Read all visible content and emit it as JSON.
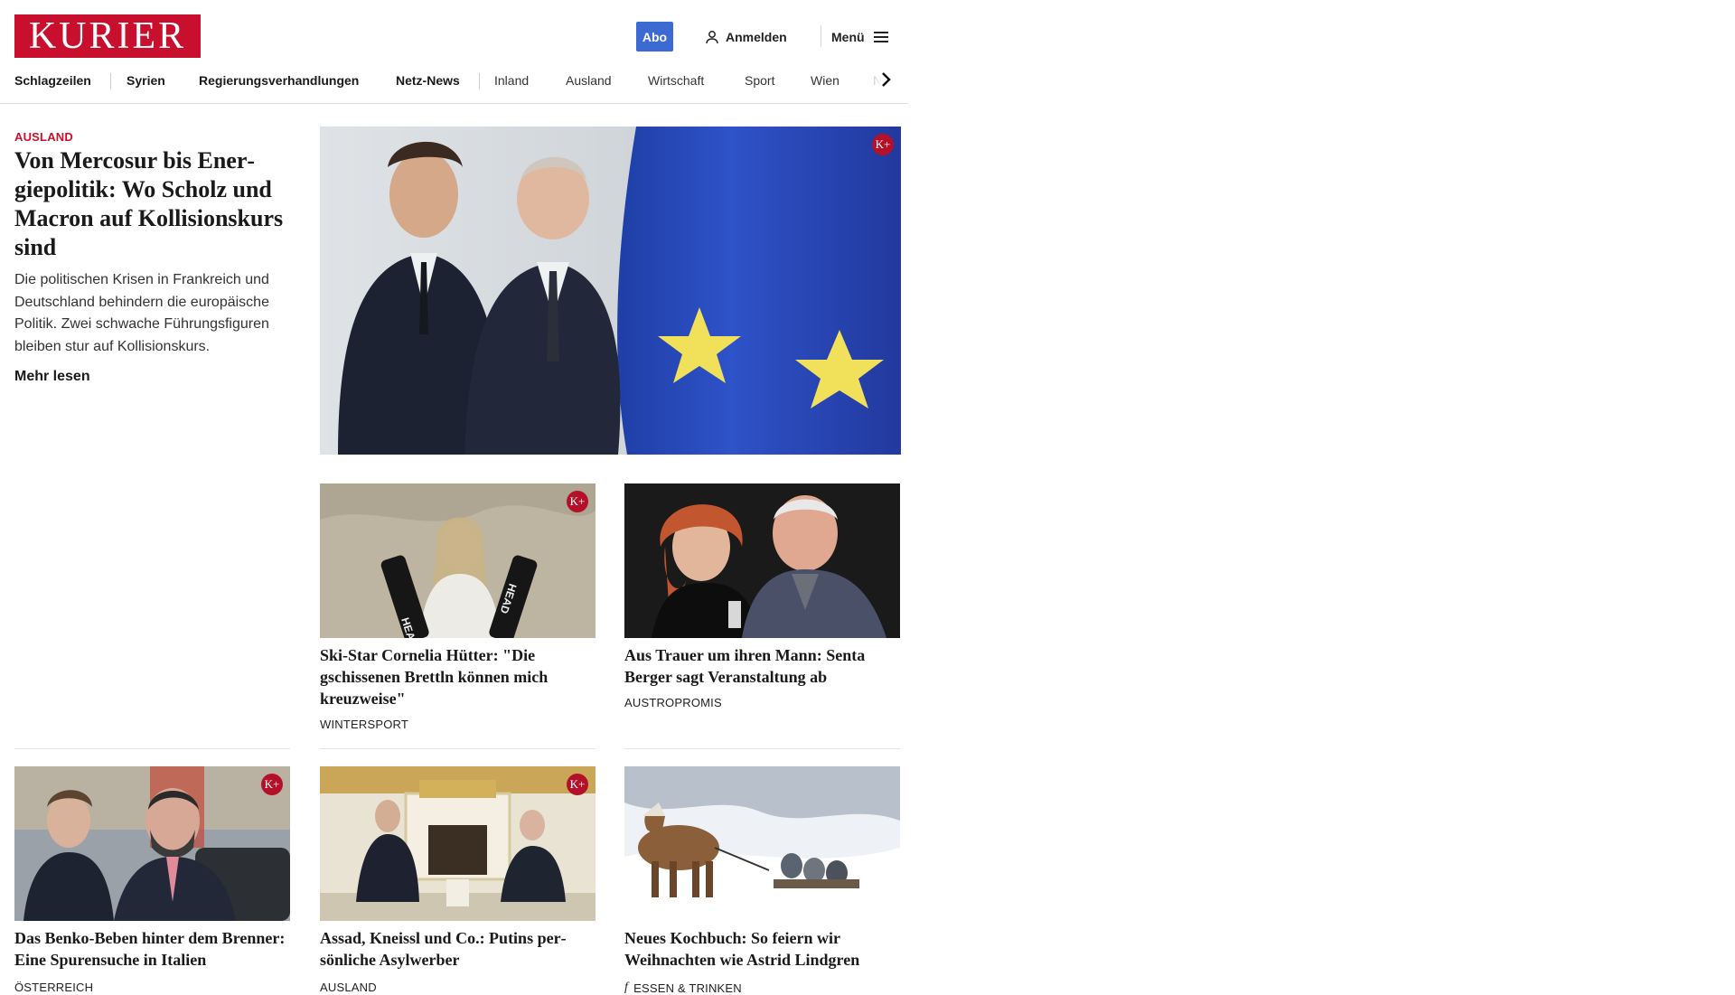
{
  "header": {
    "logo_text": "KURIER",
    "abo_label": "Abo",
    "login_label": "Anmelden",
    "menu_label": "Menü",
    "icons": [
      "user-icon",
      "hamburger-menu-icon"
    ]
  },
  "nav": {
    "items": [
      "Schlagzeilen",
      "Syrien",
      "Regierungsverhandlungen",
      "Netz-News",
      "Inland",
      "Ausland",
      "Wirtschaft",
      "Sport",
      "Wien",
      "NÖ"
    ]
  },
  "lead": {
    "kicker": "AUSLAND",
    "title": "Von Mercosur bis Ener­giepolitik: Wo Scholz und Macron auf Kollisions­kurs sind",
    "teaser": "Die politischen Krisen in Frankreich und Deutschland behindern die europäische Politik. Zwei schwache Führungsfiguren bleiben stur auf Kollisionskurs.",
    "more_label": "Mehr lesen",
    "badge": "K+"
  },
  "cards": [
    {
      "title": "Ski-Star Cornelia Hütter: \"Die gschissenen Brettln können mich kreuzweise\"",
      "kicker": "WINTERSPORT",
      "badge": "K+"
    },
    {
      "title": "Aus Trauer um ihren Mann: Senta Berger sagt Veranstaltung ab",
      "kicker": "AUSTROPROMIS",
      "badge": ""
    },
    {
      "title": "Das Benko-Beben hinter dem Bren­ner: Eine Spurensuche in Italien",
      "kicker": "ÖSTERREICH",
      "badge": "K+"
    },
    {
      "title": "Assad, Kneissl und Co.: Putins per­sönliche Asylwerber",
      "kicker": "AUSLAND",
      "badge": "K+"
    },
    {
      "title": "Neues Kochbuch: So feiern wir Weihnachten wie Astrid Lindgren",
      "kicker": "ESSEN & TRINKEN",
      "badge": ""
    }
  ],
  "colors": {
    "brand": "#c8102e",
    "abo": "#3c6ad2",
    "badge": "#b5102a"
  }
}
